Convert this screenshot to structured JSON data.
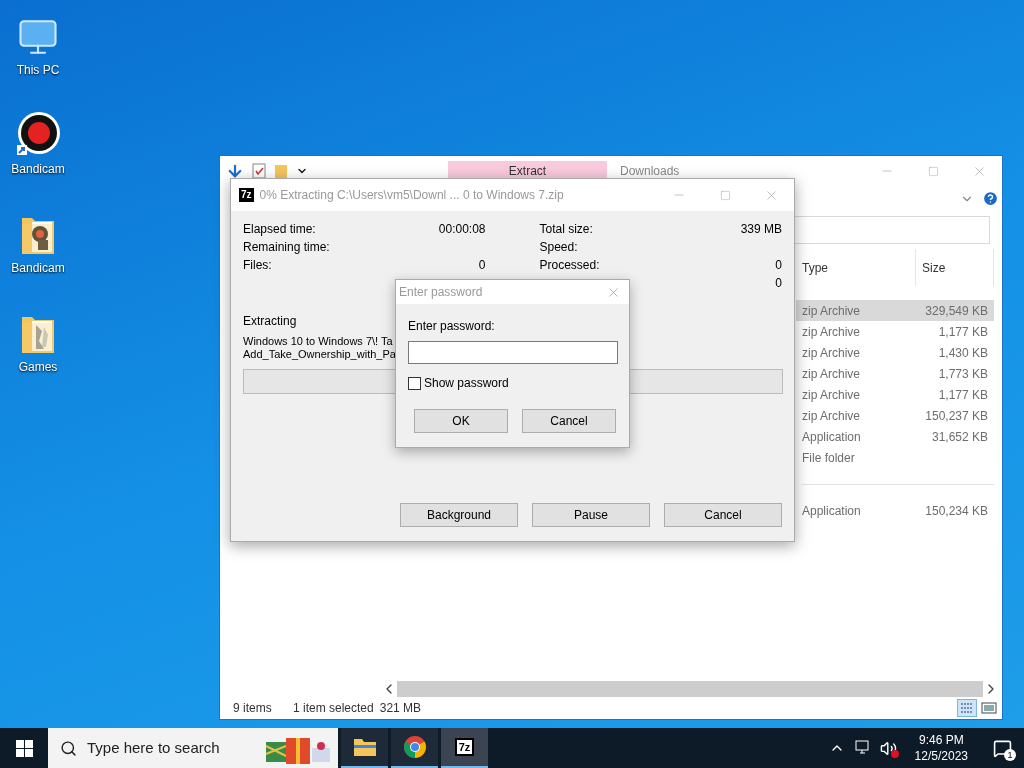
{
  "desktop_icons": [
    {
      "label": "This PC",
      "kind": "computer"
    },
    {
      "label": "Bandicam",
      "kind": "record"
    },
    {
      "label": "Bandicam",
      "kind": "folder"
    },
    {
      "label": "Games",
      "kind": "folder"
    }
  ],
  "explorer": {
    "ribbon_tab": "Extract",
    "title": "Downloads",
    "columns": [
      "Type",
      "Size"
    ],
    "rows": [
      {
        "type": "zip Archive",
        "size": "329,549 KB",
        "selected": true
      },
      {
        "type": "zip Archive",
        "size": "1,177 KB",
        "selected": false
      },
      {
        "type": "zip Archive",
        "size": "1,430 KB",
        "selected": false
      },
      {
        "type": "zip Archive",
        "size": "1,773 KB",
        "selected": false
      },
      {
        "type": "zip Archive",
        "size": "1,177 KB",
        "selected": false
      },
      {
        "type": "zip Archive",
        "size": "150,237 KB",
        "selected": false
      },
      {
        "type": "Application",
        "size": "31,652 KB",
        "selected": false
      },
      {
        "type": "File folder",
        "selected": false
      },
      {
        "kind": "gap"
      },
      {
        "type": "Application",
        "size": "150,234 KB",
        "selected": false
      }
    ],
    "status": {
      "count": "9 items",
      "selection": "1 item selected",
      "selection_size": "321 MB"
    }
  },
  "extract_dialog": {
    "icon_text": "7z",
    "title": "0% Extracting C:\\Users\\vm5\\Downl ... 0 to Windows 7.zip",
    "stats_left": [
      {
        "label": "Elapsed time:",
        "value": "00:00:08"
      },
      {
        "label": "Remaining time:"
      },
      {
        "label": "Files:",
        "value": "0"
      }
    ],
    "stats_right": [
      {
        "label": "Total size:",
        "value": "339 MB"
      },
      {
        "label": "Speed:"
      },
      {
        "label": "Processed:",
        "value": "0"
      },
      {
        "value": "0"
      }
    ],
    "section_label": "Extracting",
    "file_lines": [
      "Windows 10 to Windows 7\\! Ta",
      "Add_Take_Ownership_with_Pa"
    ],
    "level": 0,
    "buttons": [
      "Background",
      "Pause",
      "Cancel"
    ]
  },
  "password_dialog": {
    "title": "Enter password",
    "prompt": "Enter password:",
    "show_password": {
      "label": "Show password",
      "checked": false
    },
    "buttons": [
      "OK",
      "Cancel"
    ]
  },
  "taskbar": {
    "search_placeholder": "Type here to search",
    "apps": [
      {
        "kind": "folder",
        "selected": false
      },
      {
        "kind": "browser",
        "selected": false
      },
      {
        "kind": "archiver",
        "text": "7z",
        "selected": true
      }
    ],
    "time": "9:46 PM",
    "date": "12/5/2023",
    "notification_count": "1"
  }
}
